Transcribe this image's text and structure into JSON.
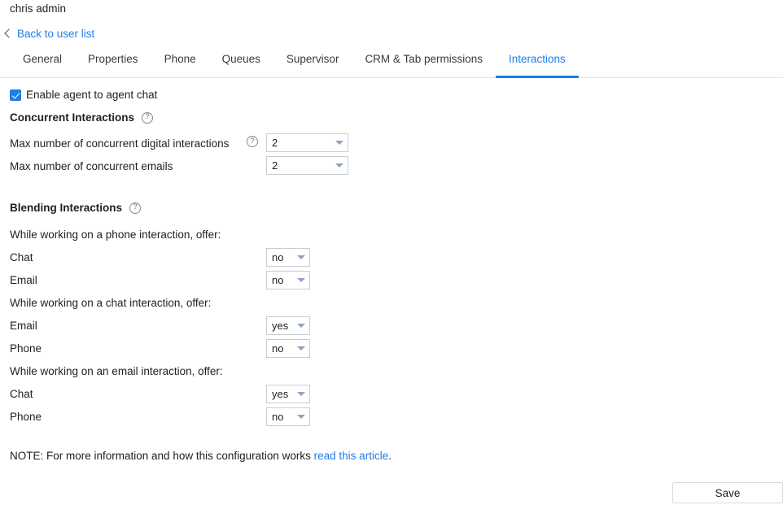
{
  "header": {
    "user_name": "chris admin",
    "back_link": "Back to user list",
    "back_icon": "chevron-left-icon"
  },
  "tabs": [
    {
      "label": "General",
      "active": false
    },
    {
      "label": "Properties",
      "active": false
    },
    {
      "label": "Phone",
      "active": false
    },
    {
      "label": "Queues",
      "active": false
    },
    {
      "label": "Supervisor",
      "active": false
    },
    {
      "label": "CRM & Tab permissions",
      "active": false
    },
    {
      "label": "Interactions",
      "active": true
    }
  ],
  "agent_chat": {
    "label": "Enable agent to agent chat",
    "checked": true
  },
  "concurrent": {
    "title": "Concurrent Interactions",
    "help_icon": "help-circle-icon",
    "fields": [
      {
        "label": "Max number of concurrent digital interactions",
        "has_help": true,
        "value": "2"
      },
      {
        "label": "Max number of concurrent emails",
        "has_help": false,
        "value": "2"
      }
    ]
  },
  "blending": {
    "title": "Blending Interactions",
    "help_icon": "help-circle-icon",
    "groups": [
      {
        "label": "While working on a phone interaction, offer:",
        "rows": [
          {
            "label": "Chat",
            "value": "no"
          },
          {
            "label": "Email",
            "value": "no"
          }
        ]
      },
      {
        "label": "While working on a chat interaction, offer:",
        "rows": [
          {
            "label": "Email",
            "value": "yes"
          },
          {
            "label": "Phone",
            "value": "no"
          }
        ]
      },
      {
        "label": "While working on an email interaction, offer:",
        "rows": [
          {
            "label": "Chat",
            "value": "yes"
          },
          {
            "label": "Phone",
            "value": "no"
          }
        ]
      }
    ]
  },
  "note": {
    "prefix": "NOTE: For more information and how this configuration works ",
    "link": "read this article",
    "suffix": "."
  },
  "footer": {
    "save_label": "Save"
  },
  "colors": {
    "accent": "#1d7ee8",
    "text": "#201f1e",
    "border": "#c8cdd4",
    "caret": "#8fa3bd"
  }
}
